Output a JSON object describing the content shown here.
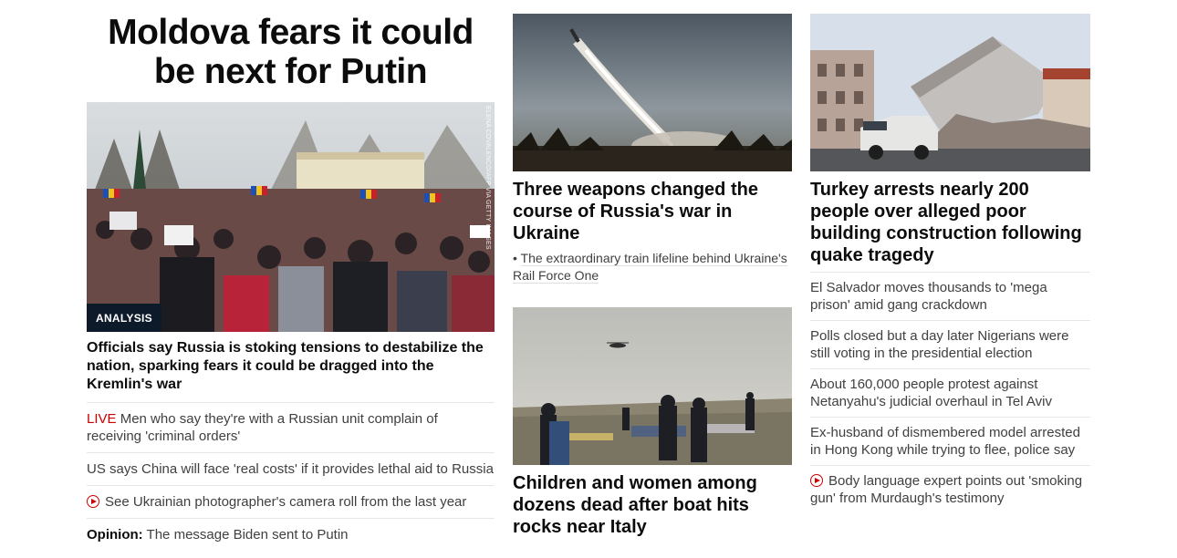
{
  "lead": {
    "title": "Moldova fears it could be next for Putin",
    "image_alt": "Crowd of protesters with flags in a city square",
    "image_credit": "ELENA COVALENCO/AFP VIA GETTY IMAGES",
    "badge": "ANALYSIS",
    "headline": "Officials say Russia is stoking tensions to destabilize the nation, sparking fears it could be dragged into the Kremlin's war",
    "items": [
      {
        "prefix": "LIVE",
        "text": " Men who say they're with a Russian unit complain of receiving 'criminal orders'"
      },
      {
        "text": "US says China will face 'real costs' if it provides lethal aid to Russia"
      },
      {
        "icon": "play-icon",
        "text": "See Ukrainian photographer's camera roll from the last year"
      },
      {
        "prefix": "Opinion:",
        "text": " The message Biden sent to Putin"
      }
    ]
  },
  "middle": {
    "card1": {
      "image_alt": "Rocket launching over a field",
      "title": "Three weapons changed the course of Russia's war in Ukraine",
      "sublink": "The extraordinary train lifeline behind Ukraine's Rail Force One"
    },
    "card2": {
      "image_alt": "Police officers on a beach with a helicopter overhead",
      "title": "Children and women among dozens dead after boat hits rocks near Italy"
    }
  },
  "right": {
    "card": {
      "image_alt": "Collapsed building with a pickup truck in front",
      "title": "Turkey arrests nearly 200 people over alleged poor building construction following quake tragedy"
    },
    "items": [
      {
        "text": "El Salvador moves thousands to 'mega prison' amid gang crackdown"
      },
      {
        "text": "Polls closed but a day later Nigerians were still voting in the presidential election"
      },
      {
        "text": "About 160,000 people protest against Netanyahu's judicial overhaul in Tel Aviv"
      },
      {
        "text": "Ex-husband of dismembered model arrested in Hong Kong while trying to flee, police say"
      },
      {
        "icon": "play-icon",
        "text": "Body language expert points out 'smoking gun' from Murdaugh's testimony"
      }
    ]
  },
  "colors": {
    "live": "#cc0000",
    "badge_bg": "#0c1a2a",
    "divider": "#e6e6e6",
    "text": "#0c0c0c",
    "muted": "#404040"
  }
}
